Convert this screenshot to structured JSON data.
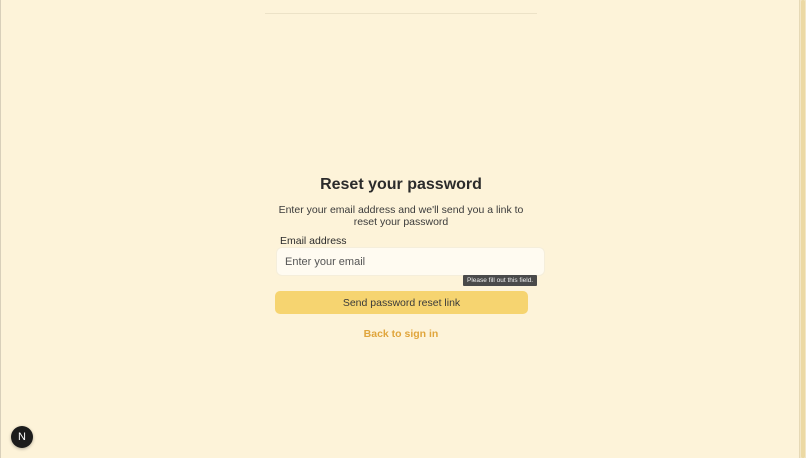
{
  "reset_form": {
    "title": "Reset your password",
    "subtitle": "Enter your email address and we'll send you a link to reset your password",
    "email_label": "Email address",
    "email_placeholder": "Enter your email",
    "email_value": "",
    "validation_tooltip": "Please fill out this field.",
    "submit_label": "Send password reset link",
    "back_link_label": "Back to sign in"
  },
  "dev_indicator": {
    "label": "N",
    "icon": "nextjs-logo-icon"
  },
  "colors": {
    "background": "#fdf3d9",
    "button": "#f6d470",
    "link": "#e0a53c",
    "fab": "#1c1c1c"
  }
}
